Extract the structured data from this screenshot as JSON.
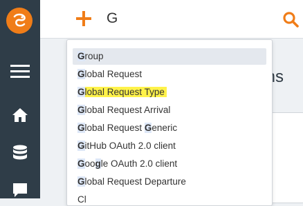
{
  "search": {
    "value": "G"
  },
  "content": {
    "heading_fragment": "ms"
  },
  "dropdown": {
    "items": [
      {
        "match": "G",
        "rest": "roup"
      },
      {
        "match": "G",
        "rest": "lobal Request"
      },
      {
        "match": "G",
        "rest": "lobal Request Type",
        "highlight_color": "#fff24a"
      },
      {
        "match": "G",
        "rest": "lobal Request Arrival"
      },
      {
        "match": "G",
        "rest": "lobal Request ",
        "match2": "G",
        "rest2": "eneric"
      },
      {
        "match": "G",
        "rest": "itHub OAuth 2.0 client"
      },
      {
        "match": "G",
        "rest": "oo",
        "match2": "g",
        "rest2": "le OAuth 2.0 client"
      },
      {
        "match": "G",
        "rest": "lobal Request Departure"
      },
      {
        "match": "",
        "rest": "Cl"
      }
    ]
  },
  "colors": {
    "accent": "#f07d18",
    "sidebar": "#2f3d48",
    "highlight": "#fff24a"
  },
  "icons": [
    "logo-icon",
    "hamburger-menu-icon",
    "home-icon",
    "database-icon",
    "chat-icon",
    "plus-icon",
    "search-icon"
  ]
}
